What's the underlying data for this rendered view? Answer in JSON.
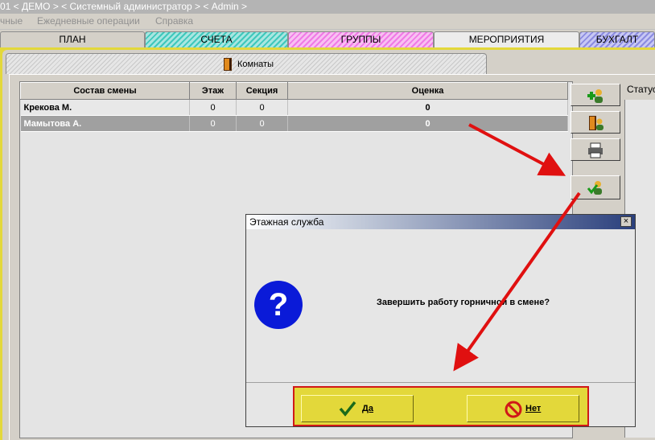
{
  "title": "01 < ДЕМО > < Системный администратор > < Admin >",
  "menu": [
    "чные",
    "Ежедневные операции",
    "Справка"
  ],
  "tabs": [
    "ПЛАН",
    "СЧЕТА",
    "ГРУППЫ",
    "МЕРОПРИЯТИЯ",
    "БУХГАЛТ"
  ],
  "subtab": {
    "label": "Комнаты",
    "icon": "door-icon"
  },
  "grid": {
    "columns": [
      "Состав смены",
      "Этаж",
      "Секция",
      "Оценка"
    ],
    "rows": [
      {
        "name": "Крекова  М.",
        "floor": "0",
        "section": "0",
        "score": "0"
      },
      {
        "name": "Мамытова  А.",
        "floor": "0",
        "section": "0",
        "score": "0"
      }
    ]
  },
  "side": {
    "status_label": "Статус"
  },
  "toolbar_icons": [
    "add-user-icon",
    "user-door-icon",
    "printer-icon",
    "user-check-icon"
  ],
  "dialog": {
    "title": "Этажная служба",
    "close": "×",
    "message": "Завершить работу горничной в смене?",
    "yes": "Да",
    "no": "Нет"
  },
  "colors": {
    "frame": "#e3d83a",
    "highlight": "#d01818",
    "selection": "#a0a0a0"
  }
}
